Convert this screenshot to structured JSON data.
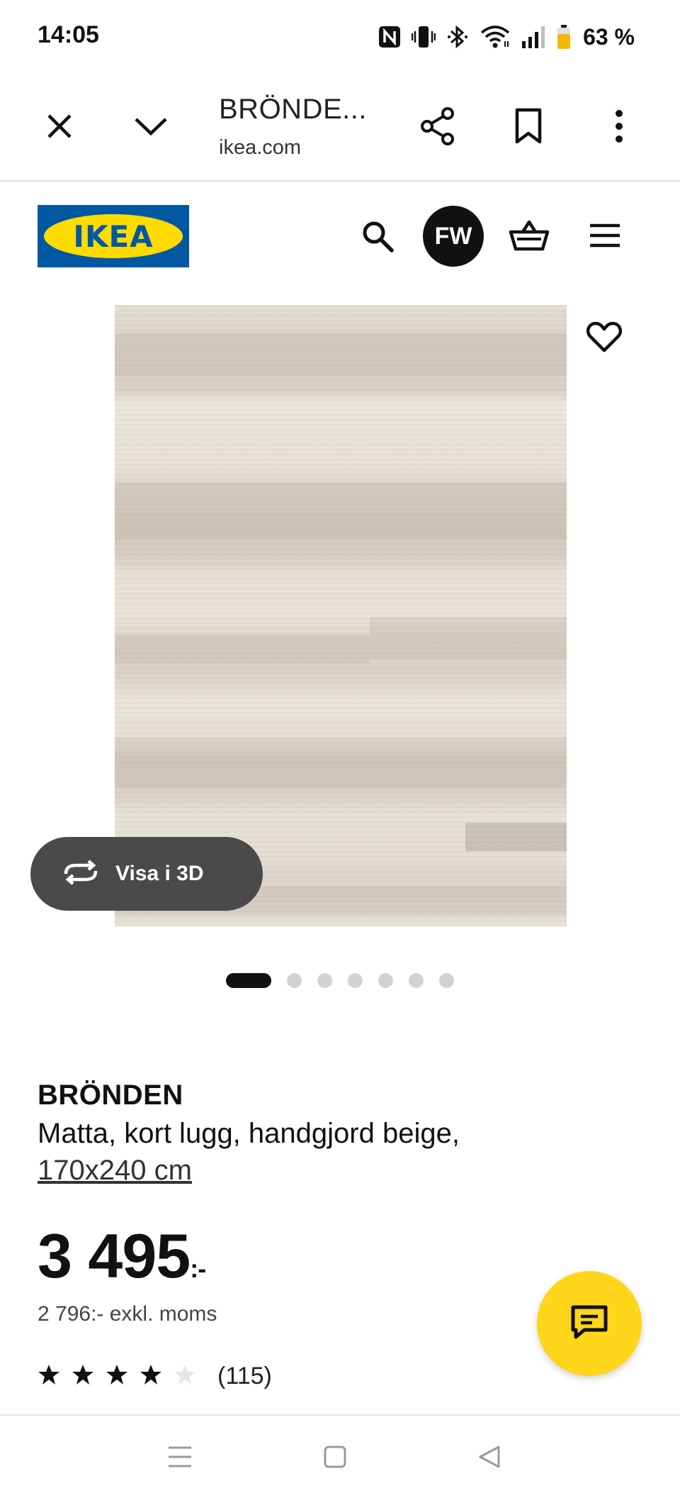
{
  "status_bar": {
    "time": "14:05",
    "battery_percent": "63 %",
    "battery_level": 0.63,
    "icons": [
      "nfc-icon",
      "vibrate-icon",
      "bluetooth-icon",
      "wifi-icon",
      "signal-icon",
      "battery-icon"
    ]
  },
  "browser": {
    "tab_title": "BRÖNDE...",
    "url": "ikea.com",
    "buttons": [
      "close-icon",
      "chevron-down-icon",
      "share-icon",
      "bookmark-icon",
      "more-vert-icon"
    ]
  },
  "header": {
    "logo_text": "IKEA",
    "avatar_initials": "FW",
    "icons": [
      "search-icon",
      "basket-icon",
      "menu-icon"
    ]
  },
  "gallery": {
    "view_3d_label": "Visa i 3D",
    "dots_total": 7,
    "active_dot": 1
  },
  "product": {
    "name": "BRÖNDEN",
    "description": "Matta, kort lugg, handgjord beige,",
    "size": "170x240 cm",
    "price": "3 495",
    "price_suffix": ":-",
    "price_excl_vat": "2 796:- exkl. moms",
    "rating": 4,
    "rating_max": 5,
    "review_count": "(115)"
  },
  "colors": {
    "ikea_blue": "#0058a3",
    "ikea_yellow": "#ffdb00",
    "fab_yellow": "#ffd61a",
    "text_dark": "#111111"
  }
}
